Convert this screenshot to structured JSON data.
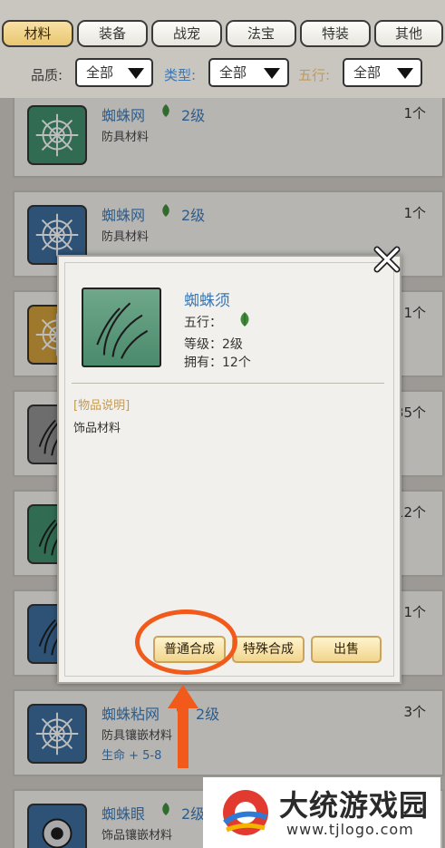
{
  "tabs": [
    {
      "label": "材料",
      "active": true
    },
    {
      "label": "装备",
      "active": false
    },
    {
      "label": "战宠",
      "active": false
    },
    {
      "label": "法宝",
      "active": false
    },
    {
      "label": "特装",
      "active": false
    },
    {
      "label": "其他",
      "active": false
    }
  ],
  "filters": {
    "quality": {
      "label": "品质:",
      "value": "全部",
      "color": "#3a3a3a"
    },
    "type": {
      "label": "类型:",
      "value": "全部",
      "color": "#3a78b5"
    },
    "element": {
      "label": "五行:",
      "value": "全部",
      "color": "#c49a55"
    }
  },
  "items": [
    {
      "name": "蜘蛛网",
      "level": "2级",
      "desc": "防具材料",
      "stat": "",
      "count": "1个",
      "icon": "spider-web-icon",
      "frame": "#3f8a6a"
    },
    {
      "name": "蜘蛛网",
      "level": "2级",
      "desc": "防具材料",
      "stat": "",
      "count": "1个",
      "icon": "spider-web-icon",
      "frame": "#3b6a96"
    },
    {
      "name": "",
      "level": "",
      "desc": "",
      "stat": "",
      "count": "1个",
      "icon": "spider-web-icon",
      "frame": "#c99a3a"
    },
    {
      "name": "",
      "level": "",
      "desc": "",
      "stat": "",
      "count": "35个",
      "icon": "spider-whisker-icon",
      "frame": "#8c8c8c"
    },
    {
      "name": "",
      "level": "",
      "desc": "",
      "stat": "",
      "count": "12个",
      "icon": "spider-whisker-icon",
      "frame": "#3f8a6a"
    },
    {
      "name": "",
      "level": "",
      "desc": "",
      "stat": "",
      "count": "1个",
      "icon": "spider-whisker-icon",
      "frame": "#3b6a96"
    },
    {
      "name": "蜘蛛粘网",
      "level": "2级",
      "desc": "防具镶嵌材料",
      "stat": "生命 + 5-8",
      "count": "3个",
      "icon": "spider-web-icon",
      "frame": "#3b6a96"
    },
    {
      "name": "蜘蛛眼",
      "level": "2级",
      "desc": "饰品镶嵌材料",
      "stat": "",
      "count": "",
      "icon": "spider-eye-icon",
      "frame": "#3b6a96"
    }
  ],
  "popup": {
    "name": "蜘蛛须",
    "element_label": "五行：",
    "level_text": "等级：2级",
    "owned_text": "拥有：12个",
    "section_title": "[物品说明]",
    "description": "饰品材料",
    "buttons": {
      "normal_craft": "普通合成",
      "special_craft": "特殊合成",
      "sell": "出售"
    },
    "icon": "spider-whisker-icon"
  },
  "watermark": {
    "title": "大统游戏园",
    "url": "www.tjlogo.com"
  },
  "colors": {
    "accent_blue": "#3a78b5",
    "highlight": "#f25a1b",
    "leaf": "#3f8a3a",
    "gold": "#c49a55"
  }
}
